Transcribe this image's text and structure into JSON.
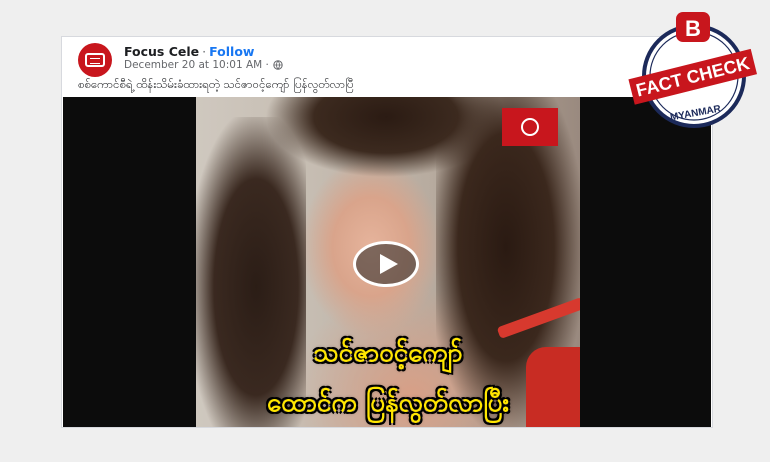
{
  "post": {
    "page_name": "Focus Cele",
    "separator": "·",
    "follow_label": "Follow",
    "timestamp": "December 20 at 10:01 AM · ",
    "caption": "စစ်ကောင်စီရဲ့ ထိန်းသိမ်းခံထားရတဲ့ သင်ဇာဝင့်ကျော် ပြန်လွတ်လာပြီ"
  },
  "video": {
    "subtitle_line1": "သင်ဇာဝင့်ကျော်",
    "subtitle_line2": "ထောင်က ပြန်လွတ်လာပြီး",
    "play_icon": "play-icon"
  },
  "fact_check_badge": {
    "letter": "B",
    "banner": "FACT CHECK",
    "region": "MYANMAR"
  },
  "colors": {
    "brand_red": "#c8161d",
    "follow_blue": "#1877f2",
    "subtitle_yellow": "#ffe600",
    "badge_navy": "#1c2a5a"
  }
}
